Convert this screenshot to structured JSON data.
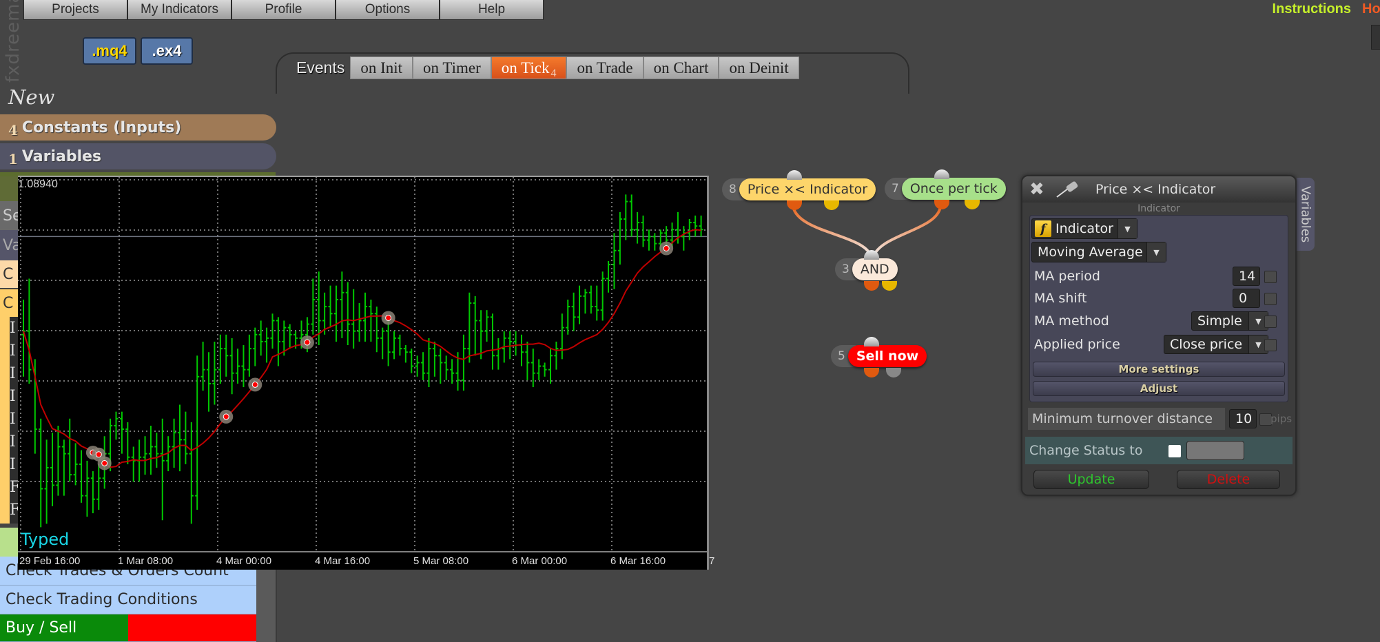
{
  "brand": "fxdreema",
  "top_menu": [
    "Projects",
    "My Indicators",
    "Profile",
    "Options",
    "Help"
  ],
  "top_links": {
    "instructions": "Instructions",
    "home": "Home"
  },
  "file_buttons": {
    "mq4": ".mq4",
    "ex4": ".ex4"
  },
  "events": {
    "label": "Events",
    "tabs": [
      {
        "label": "on Init",
        "count": ""
      },
      {
        "label": "on Timer",
        "count": ""
      },
      {
        "label": "on Tick",
        "count": "4",
        "active": true
      },
      {
        "label": "on Trade",
        "count": ""
      },
      {
        "label": "on Chart",
        "count": ""
      },
      {
        "label": "on Deinit",
        "count": ""
      }
    ]
  },
  "sidebar": {
    "new_label": "New",
    "constants": {
      "count": "4",
      "label": "Constants (Inputs)"
    },
    "variables": {
      "count": "1",
      "label": "Variables"
    },
    "peek": {
      "se": "Se",
      "va": "Va",
      "c1": "C",
      "c2": "C",
      "items": [
        "I",
        "I",
        "I",
        "I",
        "I",
        "I",
        "I",
        "F",
        "F"
      ]
    },
    "list": [
      "Check Trades & Orders Count",
      "Check Trading Conditions"
    ],
    "buy_sell": "Buy / Sell"
  },
  "chart_data": {
    "type": "ohlc",
    "top_price_label": "1.08940",
    "overlay_label": "Typed",
    "xticks": [
      "29 Feb 16:00",
      "1 Mar 08:00",
      "4 Mar 00:00",
      "4 Mar 16:00",
      "5 Mar 08:00",
      "6 Mar 00:00",
      "6 Mar 16:00",
      "7"
    ],
    "ylim": [
      1.079,
      1.0897
    ],
    "horizontal_level": 1.088,
    "bar_color": "#00c800",
    "ma_color": "#c00000",
    "ma": {
      "name": "Moving Average",
      "period": 14
    },
    "bars": [
      [
        1.0852,
        1.0862,
        1.084,
        1.0853
      ],
      [
        1.0853,
        1.0868,
        1.0838,
        1.0842
      ],
      [
        1.0842,
        1.0845,
        1.0818,
        1.0825
      ],
      [
        1.0825,
        1.0828,
        1.0797,
        1.0808
      ],
      [
        1.0808,
        1.0822,
        1.0798,
        1.0814
      ],
      [
        1.0814,
        1.0824,
        1.0803,
        1.0809
      ],
      [
        1.0809,
        1.0826,
        1.0806,
        1.082
      ],
      [
        1.082,
        1.0822,
        1.0806,
        1.0818
      ],
      [
        1.0818,
        1.0828,
        1.081,
        1.0812
      ],
      [
        1.0812,
        1.0821,
        1.0809,
        1.0815
      ],
      [
        1.0815,
        1.0819,
        1.0804,
        1.0806
      ],
      [
        1.0806,
        1.0816,
        1.08,
        1.0811
      ],
      [
        1.0811,
        1.0813,
        1.0801,
        1.0805
      ],
      [
        1.0805,
        1.0815,
        1.0802,
        1.0811
      ],
      [
        1.0811,
        1.0823,
        1.0808,
        1.0818
      ],
      [
        1.0818,
        1.0828,
        1.0813,
        1.0826
      ],
      [
        1.0826,
        1.083,
        1.0822,
        1.0828
      ],
      [
        1.0828,
        1.083,
        1.0818,
        1.0825
      ],
      [
        1.0825,
        1.0827,
        1.0815,
        1.0817
      ],
      [
        1.0817,
        1.082,
        1.081,
        1.0816
      ],
      [
        1.0816,
        1.0822,
        1.081,
        1.0817
      ],
      [
        1.0817,
        1.0823,
        1.0812,
        1.0818
      ],
      [
        1.0818,
        1.0826,
        1.0812,
        1.082
      ],
      [
        1.082,
        1.0824,
        1.0814,
        1.0818
      ],
      [
        1.0818,
        1.0828,
        1.0799,
        1.0816
      ],
      [
        1.0816,
        1.0823,
        1.0813,
        1.082
      ],
      [
        1.082,
        1.0828,
        1.0814,
        1.0824
      ],
      [
        1.0824,
        1.0832,
        1.0813,
        1.0822
      ],
      [
        1.0822,
        1.083,
        1.0815,
        1.0818
      ],
      [
        1.0818,
        1.0827,
        1.0798,
        1.0806
      ],
      [
        1.0806,
        1.0846,
        1.0802,
        1.084
      ],
      [
        1.084,
        1.085,
        1.0836,
        1.0842
      ],
      [
        1.0842,
        1.0847,
        1.083,
        1.0838
      ],
      [
        1.0838,
        1.085,
        1.0832,
        1.0842
      ],
      [
        1.0842,
        1.0852,
        1.0838,
        1.0848
      ],
      [
        1.0848,
        1.0852,
        1.084,
        1.0846
      ],
      [
        1.0846,
        1.0851,
        1.0835,
        1.0841
      ],
      [
        1.0841,
        1.0848,
        1.0838,
        1.0843
      ],
      [
        1.0843,
        1.0849,
        1.0837,
        1.0842
      ],
      [
        1.0842,
        1.0852,
        1.084,
        1.0848
      ],
      [
        1.0848,
        1.0854,
        1.0843,
        1.0852
      ],
      [
        1.0852,
        1.0856,
        1.0846,
        1.085
      ],
      [
        1.085,
        1.0854,
        1.0844,
        1.0851
      ],
      [
        1.0851,
        1.0858,
        1.0848,
        1.0856
      ],
      [
        1.0856,
        1.0857,
        1.0843,
        1.085
      ],
      [
        1.085,
        1.0856,
        1.0846,
        1.0854
      ],
      [
        1.0854,
        1.0855,
        1.0848,
        1.0852
      ],
      [
        1.0852,
        1.0853,
        1.0848,
        1.0851
      ],
      [
        1.0851,
        1.0856,
        1.0848,
        1.0852
      ],
      [
        1.0852,
        1.0857,
        1.0847,
        1.0855
      ],
      [
        1.0855,
        1.0868,
        1.0852,
        1.0862
      ],
      [
        1.0862,
        1.087,
        1.0849,
        1.0856
      ],
      [
        1.0856,
        1.0864,
        1.0852,
        1.086
      ],
      [
        1.086,
        1.0866,
        1.0854,
        1.0858
      ],
      [
        1.0858,
        1.0866,
        1.085,
        1.0862
      ],
      [
        1.0862,
        1.087,
        1.0851,
        1.0864
      ],
      [
        1.0864,
        1.0867,
        1.0849,
        1.0855
      ],
      [
        1.0855,
        1.0865,
        1.0848,
        1.0853
      ],
      [
        1.0853,
        1.0861,
        1.085,
        1.0856
      ],
      [
        1.0856,
        1.0864,
        1.085,
        1.086
      ],
      [
        1.086,
        1.0862,
        1.085,
        1.0858
      ],
      [
        1.0858,
        1.086,
        1.0847,
        1.0851
      ],
      [
        1.0851,
        1.0854,
        1.0845,
        1.0853
      ],
      [
        1.0853,
        1.0856,
        1.0843,
        1.0847
      ],
      [
        1.0847,
        1.0853,
        1.0845,
        1.0851
      ],
      [
        1.0851,
        1.0852,
        1.0846,
        1.0848
      ],
      [
        1.0848,
        1.0849,
        1.0844,
        1.0847
      ],
      [
        1.0847,
        1.0848,
        1.0841,
        1.0843
      ],
      [
        1.0843,
        1.0846,
        1.084,
        1.0844
      ],
      [
        1.0844,
        1.0847,
        1.0839,
        1.0841
      ],
      [
        1.0841,
        1.0851,
        1.0837,
        1.0848
      ],
      [
        1.0848,
        1.085,
        1.084,
        1.0846
      ],
      [
        1.0846,
        1.0848,
        1.0838,
        1.0844
      ],
      [
        1.0844,
        1.0846,
        1.0839,
        1.0842
      ],
      [
        1.0842,
        1.0845,
        1.0838,
        1.0841
      ],
      [
        1.0841,
        1.0847,
        1.0836,
        1.0839
      ],
      [
        1.0839,
        1.0852,
        1.0836,
        1.0848
      ],
      [
        1.0848,
        1.0864,
        1.0844,
        1.0861
      ],
      [
        1.0861,
        1.0863,
        1.0846,
        1.0856
      ],
      [
        1.0856,
        1.0859,
        1.0845,
        1.0853
      ],
      [
        1.0853,
        1.0859,
        1.085,
        1.0857
      ],
      [
        1.0857,
        1.0858,
        1.0842,
        1.0846
      ],
      [
        1.0846,
        1.0851,
        1.0842,
        1.0848
      ],
      [
        1.0848,
        1.0853,
        1.0844,
        1.0851
      ],
      [
        1.0851,
        1.0853,
        1.0845,
        1.085
      ],
      [
        1.085,
        1.0853,
        1.0846,
        1.0849
      ],
      [
        1.0849,
        1.0852,
        1.0843,
        1.0847
      ],
      [
        1.0847,
        1.085,
        1.0839,
        1.0844
      ],
      [
        1.0844,
        1.0848,
        1.0837,
        1.0841
      ],
      [
        1.0841,
        1.0845,
        1.0839,
        1.0843
      ],
      [
        1.0843,
        1.0844,
        1.084,
        1.0842
      ],
      [
        1.0842,
        1.0848,
        1.0838,
        1.0846
      ],
      [
        1.0846,
        1.085,
        1.0842,
        1.0848
      ],
      [
        1.0848,
        1.0858,
        1.0845,
        1.0854
      ],
      [
        1.0854,
        1.0862,
        1.0852,
        1.086
      ],
      [
        1.086,
        1.0864,
        1.0853,
        1.0857
      ],
      [
        1.0857,
        1.0866,
        1.0855,
        1.0863
      ],
      [
        1.0863,
        1.0865,
        1.0858,
        1.0864
      ],
      [
        1.0864,
        1.0866,
        1.0858,
        1.086
      ],
      [
        1.086,
        1.0866,
        1.0856,
        1.0859
      ],
      [
        1.0859,
        1.087,
        1.0856,
        1.0868
      ],
      [
        1.0868,
        1.0873,
        1.0864,
        1.0872
      ],
      [
        1.0872,
        1.0881,
        1.0865,
        1.0876
      ],
      [
        1.0876,
        1.0887,
        1.0872,
        1.0885
      ],
      [
        1.0885,
        1.0892,
        1.0879,
        1.089
      ],
      [
        1.089,
        1.0892,
        1.088,
        1.0882
      ],
      [
        1.0882,
        1.0887,
        1.0878,
        1.0884
      ],
      [
        1.0884,
        1.0886,
        1.0877,
        1.0879
      ],
      [
        1.0879,
        1.0882,
        1.0876,
        1.088
      ],
      [
        1.088,
        1.0881,
        1.0876,
        1.0878
      ],
      [
        1.0878,
        1.0882,
        1.0876,
        1.0881
      ],
      [
        1.0881,
        1.0883,
        1.0876,
        1.0879
      ],
      [
        1.0879,
        1.0884,
        1.0877,
        1.0882
      ],
      [
        1.0882,
        1.0887,
        1.0878,
        1.088
      ],
      [
        1.088,
        1.0883,
        1.0876,
        1.0881
      ],
      [
        1.0881,
        1.0885,
        1.0879,
        1.0884
      ],
      [
        1.0884,
        1.0886,
        1.088,
        1.0883
      ],
      [
        1.0883,
        1.0886,
        1.088,
        1.0882
      ]
    ],
    "signals": [
      12,
      13,
      14,
      35,
      40,
      49,
      63,
      111
    ]
  },
  "flow": {
    "nodes": [
      {
        "id": "8",
        "label": "Price ×< Indicator",
        "color": "#fdd56a"
      },
      {
        "id": "7",
        "label": "Once per tick",
        "color": "#a7e08a"
      },
      {
        "id": "3",
        "label": "AND",
        "color": "#fbe9da"
      },
      {
        "id": "5",
        "label": "Sell now",
        "color": "#ff0000"
      }
    ]
  },
  "panel": {
    "title": "Price ×< Indicator",
    "side_tab": "Variables",
    "section_caption": "Indicator",
    "type_select": "Indicator",
    "indicator_select": "Moving Average",
    "params": [
      {
        "label": "MA period",
        "value": "14"
      },
      {
        "label": "MA shift",
        "value": "0"
      },
      {
        "label": "MA method",
        "value": "Simple"
      },
      {
        "label": "Applied price",
        "value": "Close price"
      }
    ],
    "more_settings": "More settings",
    "adjust": "Adjust",
    "min_turnover_label": "Minimum turnover distance",
    "min_turnover_value": "10",
    "pips": "pips",
    "change_status_label": "Change Status to",
    "update": "Update",
    "delete": "Delete"
  }
}
